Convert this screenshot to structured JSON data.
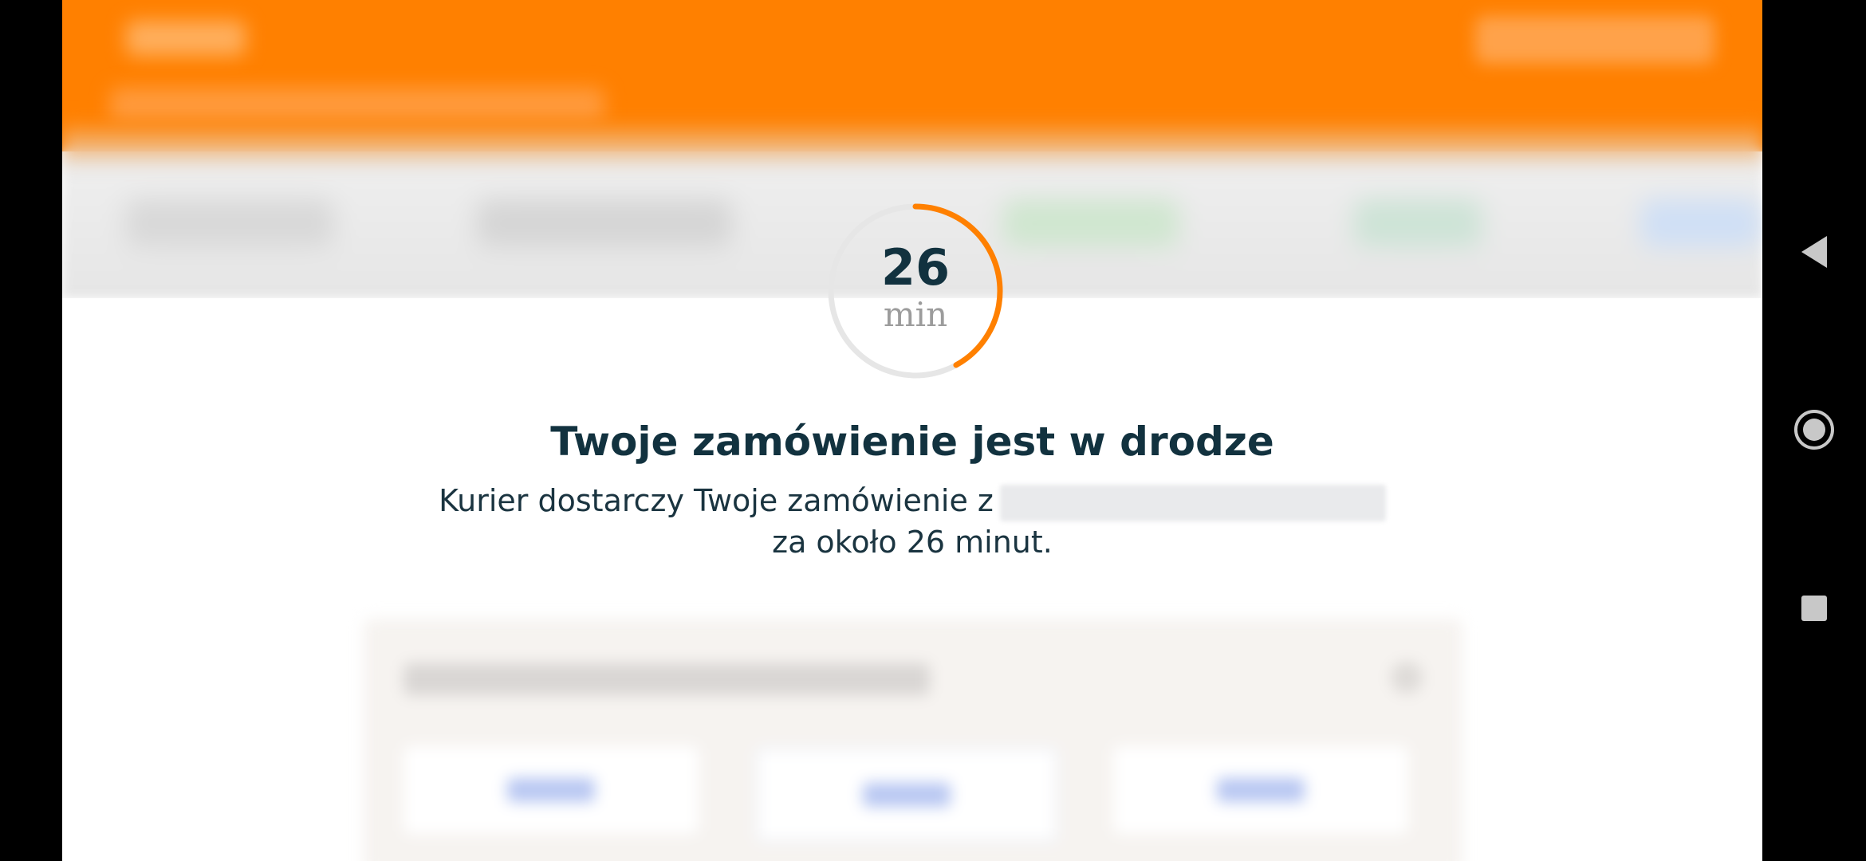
{
  "timer": {
    "value": "26",
    "unit": "min",
    "progress_fraction": 0.42,
    "accent_color": "#ff8000",
    "track_color": "#e6e6e6"
  },
  "order_status": {
    "title": "Twoje zamówienie jest w drodze",
    "line1_prefix": "Kurier dostarczy Twoje zamówienie z",
    "line2": "za około 26 minut."
  },
  "colors": {
    "brand": "#ff8000",
    "text_dark": "#12323f"
  },
  "system_nav": {
    "back_icon": "back-triangle-icon",
    "home_icon": "home-circle-icon",
    "recents_icon": "recents-square-icon"
  }
}
